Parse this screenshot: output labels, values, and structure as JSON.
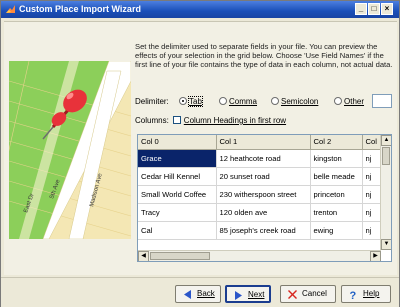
{
  "window": {
    "title": "Custom Place Import Wizard",
    "controls": [
      "_",
      "□",
      "×"
    ]
  },
  "instructions": "Set the delimiter used to separate fields in your file. You can preview the effects of your selection in the grid below. Choose 'Use Field Names' if the first line of your file contains the type of data in each column, not actual data.",
  "delimiter": {
    "label": "Delimiter:",
    "options": [
      "Tab",
      "Comma",
      "Semicolon",
      "Other"
    ],
    "selected": "Tab",
    "other_value": ""
  },
  "columns": {
    "label": "Columns:",
    "checkbox_label": "Column Headings in first row",
    "checked": false
  },
  "grid": {
    "headers": [
      "Col 0",
      "Col 1",
      "Col 2",
      "Col"
    ],
    "rows": [
      [
        "Grace",
        "12 heathcote road",
        "kingston",
        "nj"
      ],
      [
        "Cedar Hill Kennel",
        "20 sunset road",
        "belle meade",
        "nj"
      ],
      [
        "Small World Coffee",
        "230 witherspoon street",
        "princeton",
        "nj"
      ],
      [
        "Tracy",
        "120 olden ave",
        "trenton",
        "nj"
      ],
      [
        "Cal",
        "85 joseph's creek road",
        "ewing",
        "nj"
      ]
    ],
    "selected_cell": "Grace"
  },
  "map": {
    "streets": [
      "East Dr",
      "5th Ave",
      "Madison Ave"
    ]
  },
  "buttons": {
    "back": "Back",
    "next": "Next",
    "cancel": "Cancel",
    "help": "Help"
  },
  "colors": {
    "title_bar": "#1a4fb8",
    "selection": "#0a246a",
    "pin": "#e8323a",
    "map_green": "#8ccf5a"
  }
}
